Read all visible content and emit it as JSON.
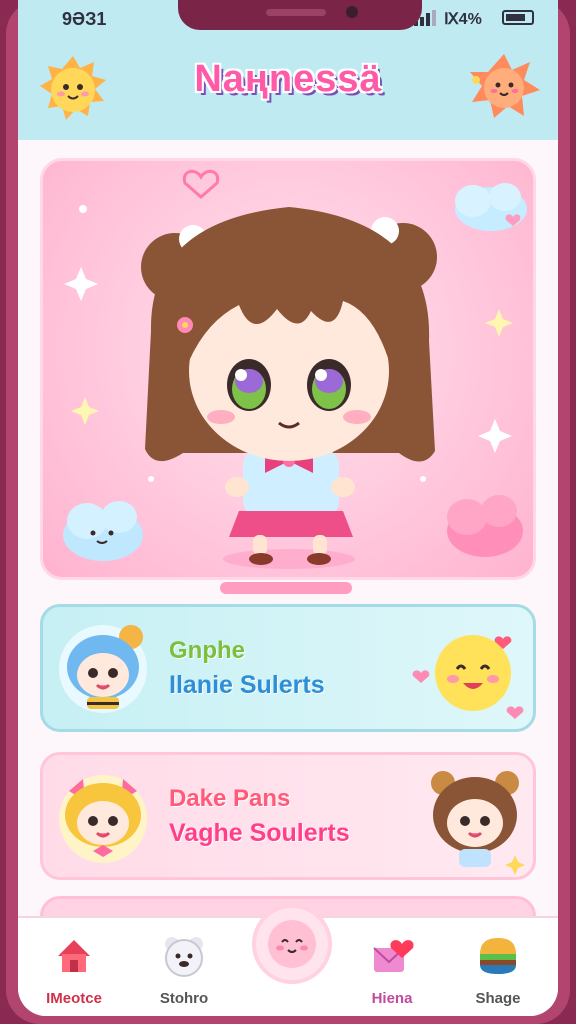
{
  "status": {
    "time": "9ƏЗ1",
    "battery_text": "Ⅸ4%"
  },
  "app": {
    "title": "Naңnessä"
  },
  "cards": [
    {
      "title": "Gnphe",
      "subtitle": "Ilanie Sulerts"
    },
    {
      "title": "Dake Pans",
      "subtitle": "Vaghe Soulerts"
    }
  ],
  "nav": {
    "items": [
      {
        "label": "IMeotce",
        "icon": "house-icon"
      },
      {
        "label": "Stohro",
        "icon": "bear-icon"
      },
      {
        "label": "",
        "icon": "blob-face-icon"
      },
      {
        "label": "Hiena",
        "icon": "heart-envelope-icon"
      },
      {
        "label": "Shage",
        "icon": "burger-icon"
      }
    ]
  },
  "colors": {
    "header_bg": "#bfeaf2",
    "frame": "#b2456f",
    "accent_pink": "#ff5aa8",
    "card_blue": "#c6f0f4",
    "card_pink": "#ffdbe8"
  }
}
